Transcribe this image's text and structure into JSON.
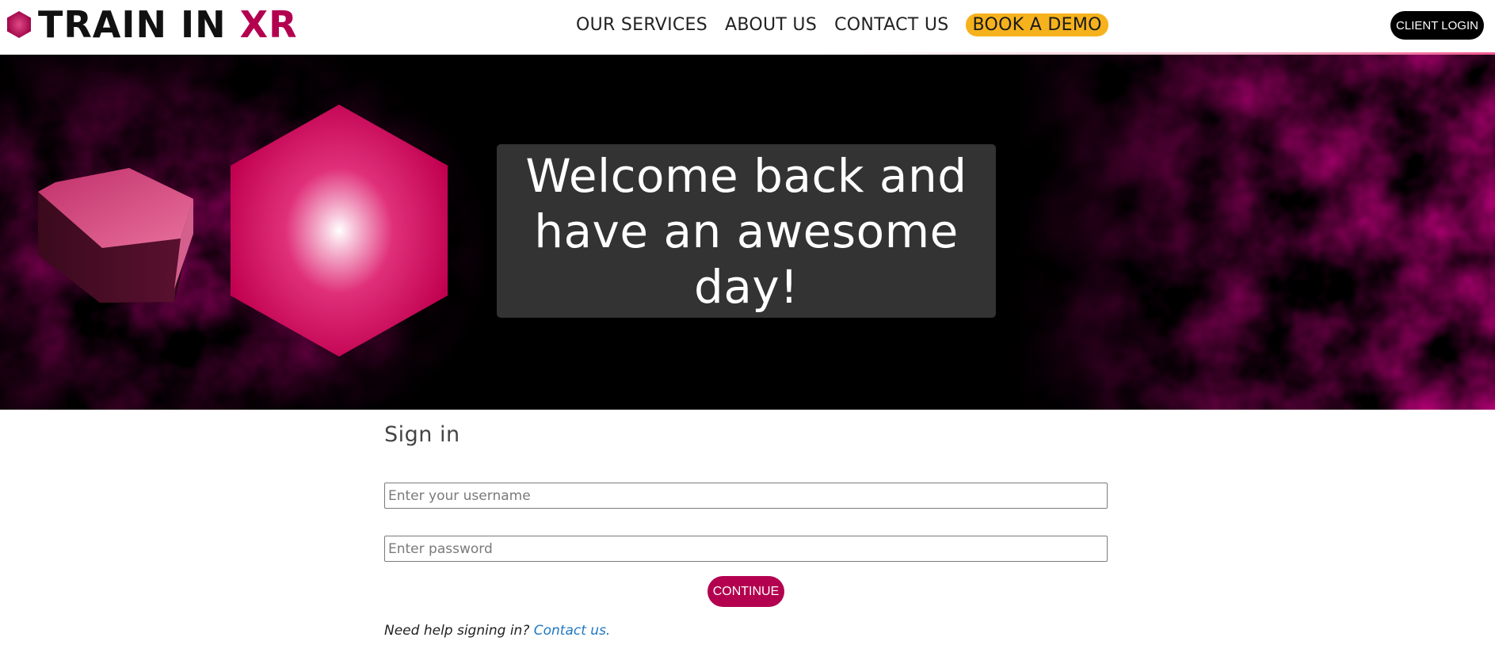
{
  "header": {
    "logo": {
      "prefix": "TRAIN IN ",
      "accent": "XR",
      "icon": "hexagon-logo-icon"
    },
    "nav": [
      {
        "label": "OUR SERVICES"
      },
      {
        "label": "ABOUT US"
      },
      {
        "label": "CONTACT US"
      },
      {
        "label": "BOOK A DEMO"
      }
    ],
    "client_login": "CLIENT LOGIN"
  },
  "hero": {
    "welcome": "Welcome back and have an awesome day!"
  },
  "signin": {
    "title": "Sign in",
    "username_placeholder": "Enter your username",
    "password_placeholder": "Enter password",
    "continue_label": "CONTINUE",
    "help_text": "Need help signing in?",
    "help_link": "Contact us."
  },
  "colors": {
    "accent": "#b3004f",
    "demo_button": "#f6b21c",
    "hero_pink": "#e8005a",
    "welcome_box": "#333333",
    "link": "#1f77c4"
  }
}
